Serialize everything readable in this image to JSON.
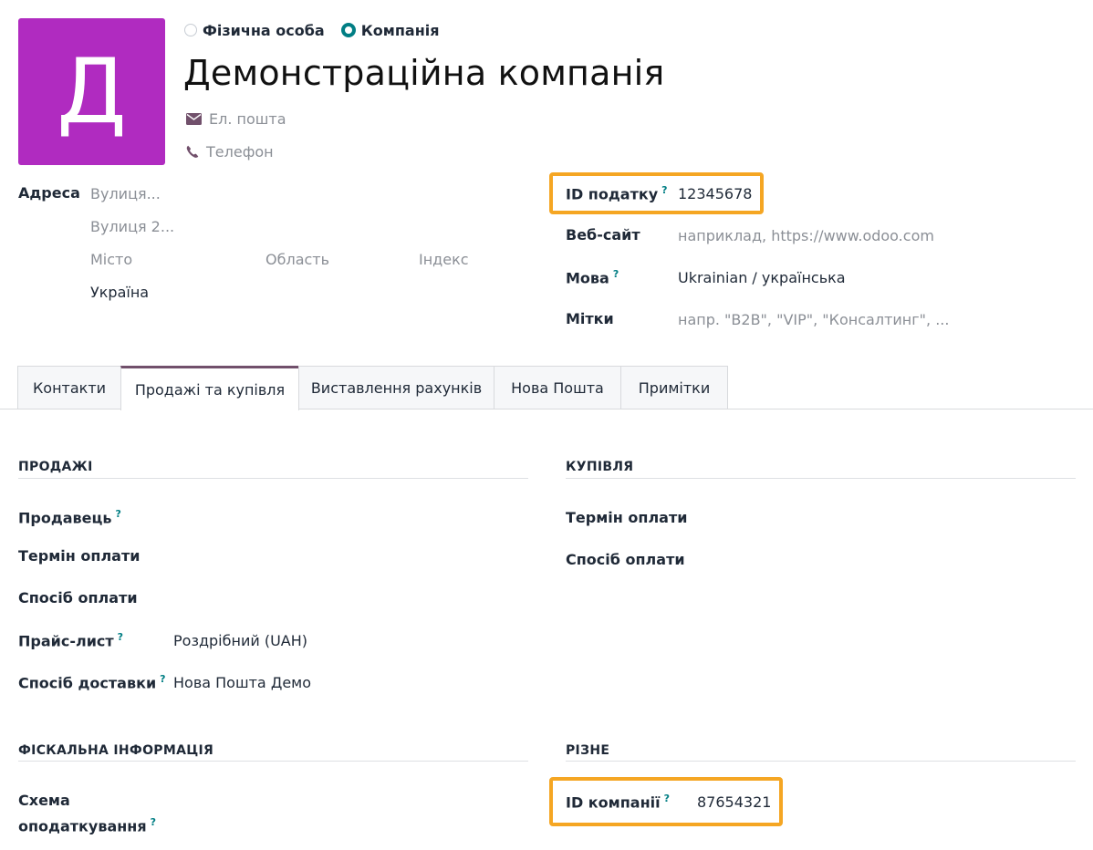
{
  "header": {
    "avatar_letter": "Д",
    "radio_person": "Фізична особа",
    "radio_company": "Компанія",
    "company_name": "Демонстраційна компанія",
    "email_placeholder": "Ел. пошта",
    "phone_placeholder": "Телефон"
  },
  "address": {
    "label": "Адреса",
    "street_placeholder": "Вулиця...",
    "street2_placeholder": "Вулиця 2...",
    "city_placeholder": "Місто",
    "state_placeholder": "Область",
    "zip_placeholder": "Індекс",
    "country": "Україна"
  },
  "right_fields": {
    "tax_id_label": "ID податку",
    "tax_id_value": "12345678",
    "website_label": "Веб-сайт",
    "website_placeholder": "наприклад, https://www.odoo.com",
    "language_label": "Мова",
    "language_value": "Ukrainian / українська",
    "tags_label": "Мітки",
    "tags_placeholder": "напр. \"B2B\", \"VIP\", \"Консалтинг\", ..."
  },
  "tabs": [
    {
      "label": "Контакти"
    },
    {
      "label": "Продажі та купівля"
    },
    {
      "label": "Виставлення рахунків"
    },
    {
      "label": "Нова Пошта"
    },
    {
      "label": "Примітки"
    }
  ],
  "help_mark": "?",
  "sales": {
    "title": "ПРОДАЖІ",
    "salesperson_label": "Продавець",
    "payment_terms_label": "Термін оплати",
    "payment_method_label": "Спосіб оплати",
    "pricelist_label": "Прайс-лист",
    "pricelist_value": "Роздрібний (UAH)",
    "delivery_label": "Спосіб доставки",
    "delivery_value": "Нова Пошта Демо"
  },
  "purchase": {
    "title": "КУПІВЛЯ",
    "payment_terms_label": "Термін оплати",
    "payment_method_label": "Спосіб оплати"
  },
  "fiscal": {
    "title": "ФІСКАЛЬНА ІНФОРМАЦІЯ",
    "tax_scheme_label_line1": "Схема",
    "tax_scheme_label_line2": "оподаткування"
  },
  "misc": {
    "title": "РІЗНЕ",
    "company_id_label": "ID компанії",
    "company_id_value": "87654321"
  },
  "colors": {
    "avatar_bg": "#b02bc0",
    "accent": "#017e84",
    "highlight": "#f5a623",
    "active_tab_border": "#71506b"
  }
}
